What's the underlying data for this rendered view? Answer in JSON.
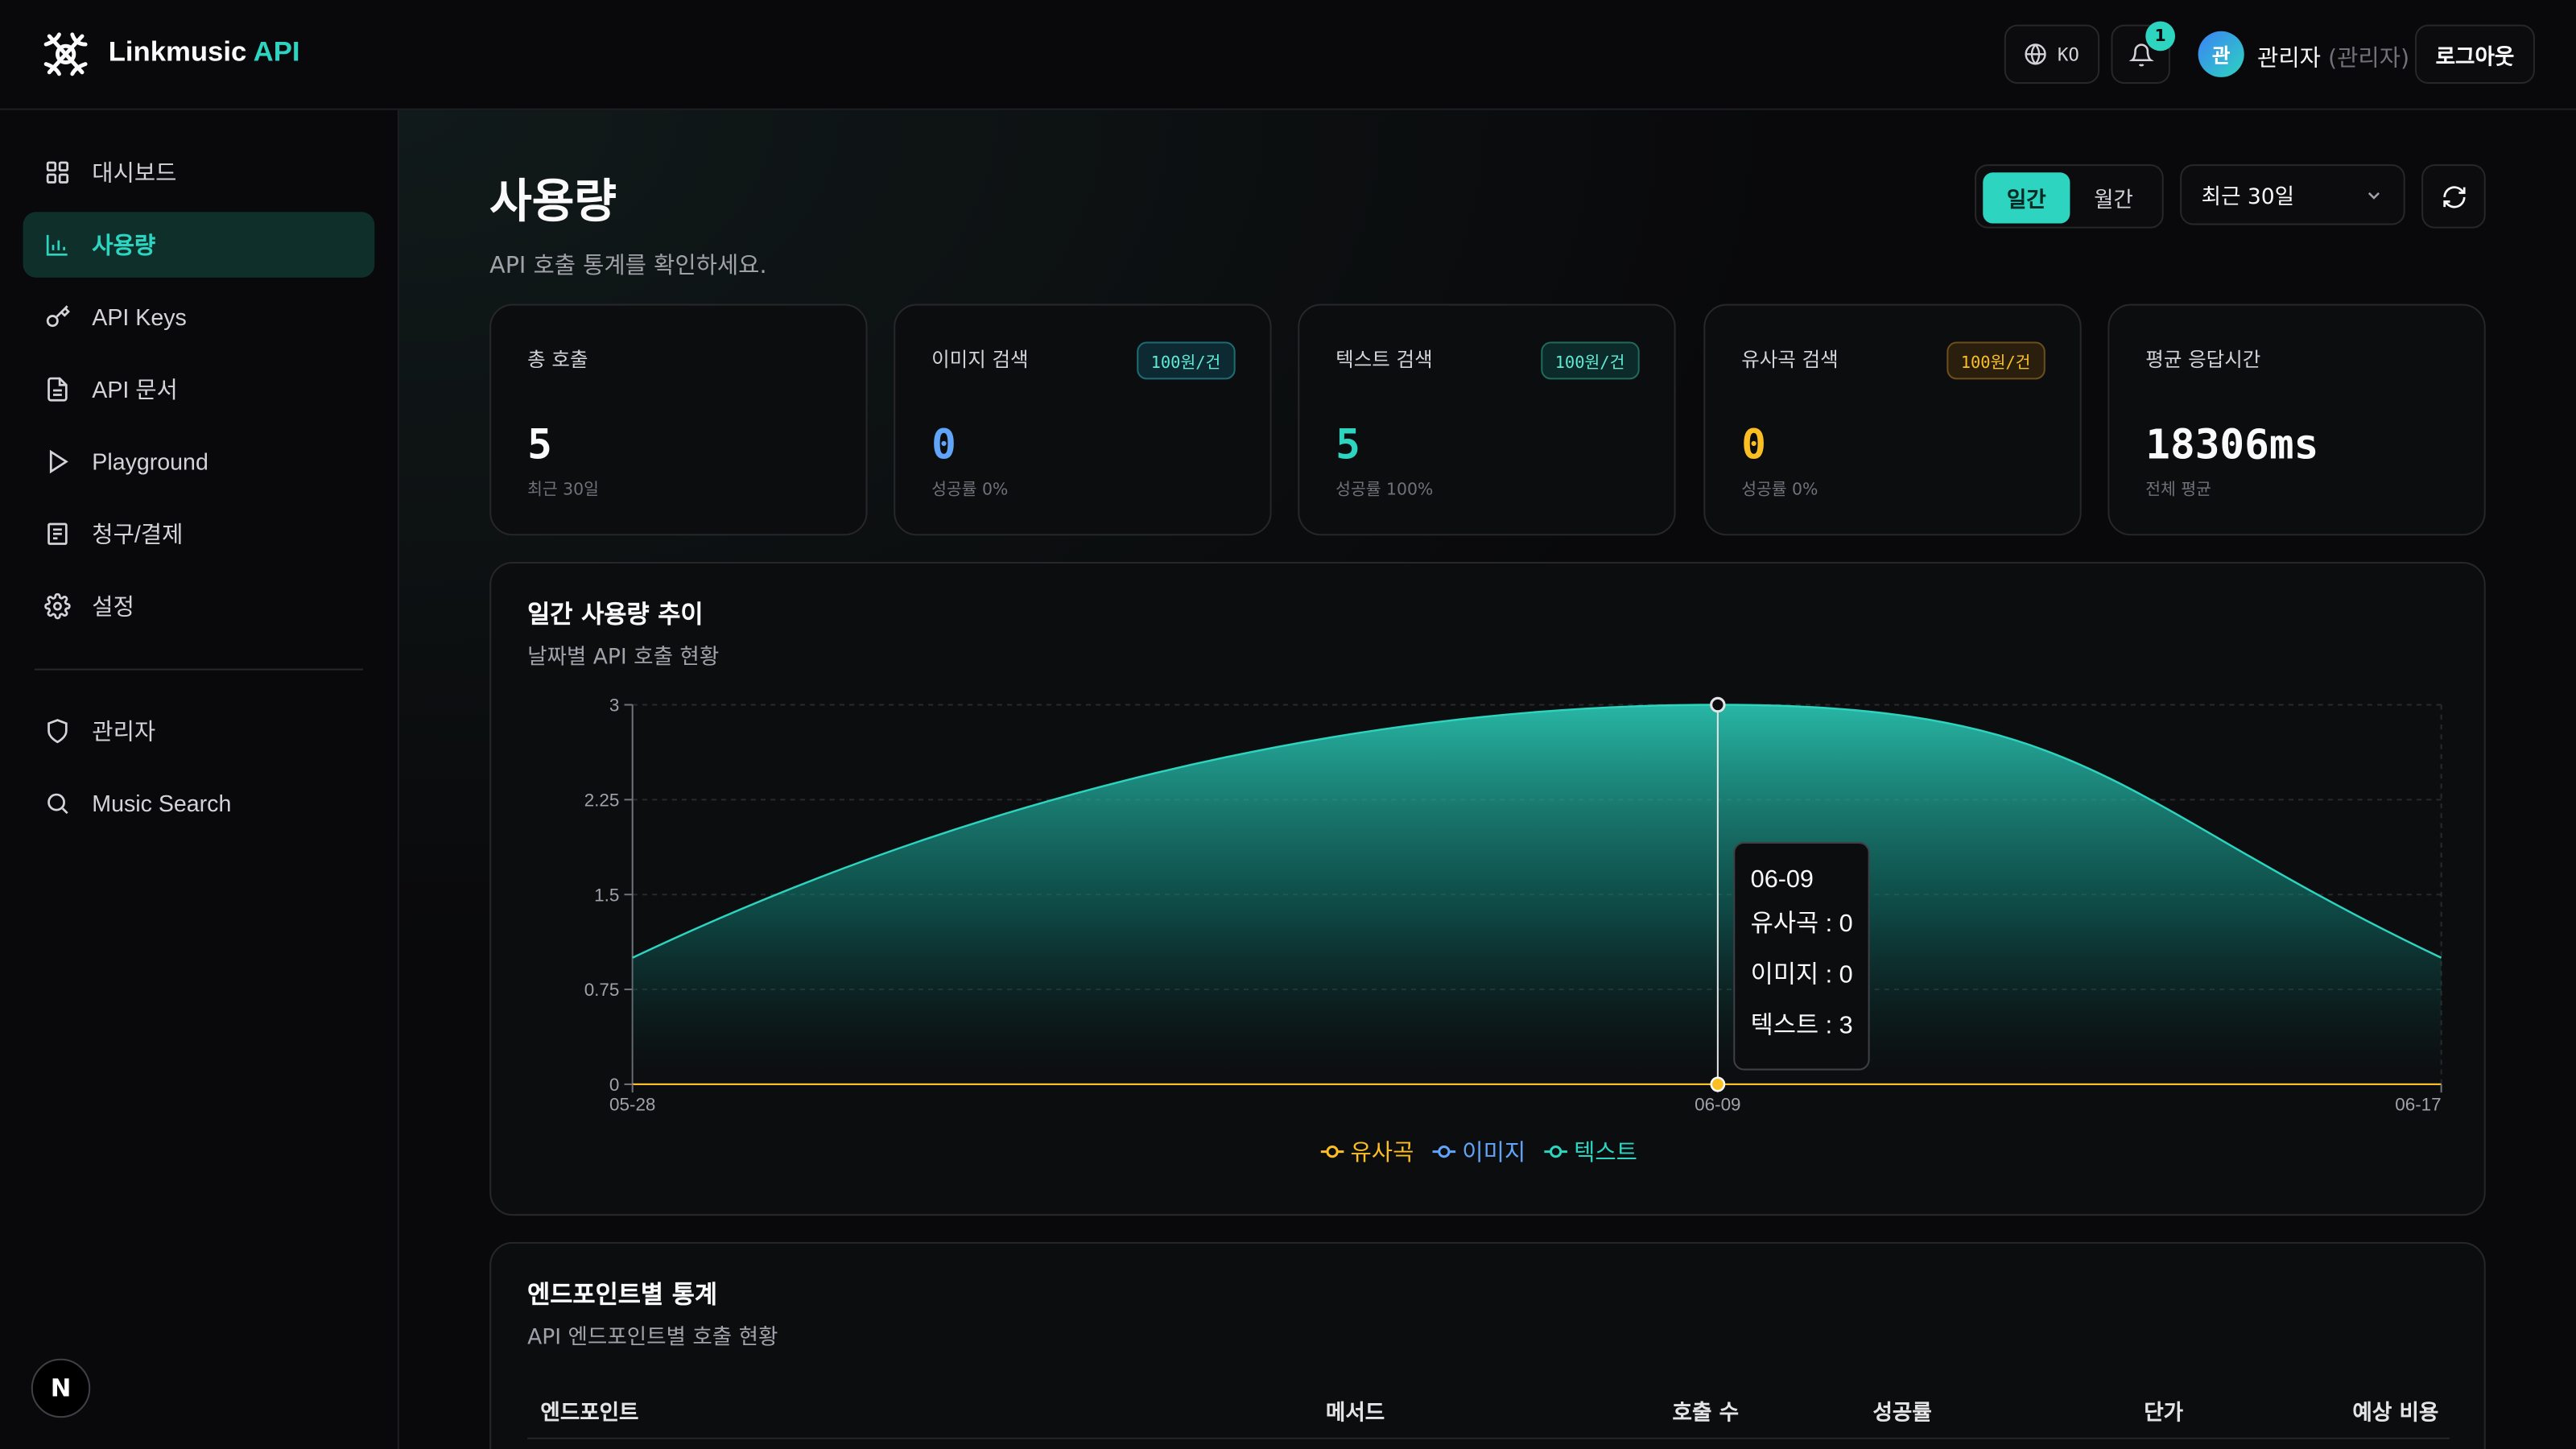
{
  "header": {
    "brand_main": "Linkmusic",
    "brand_accent": "API",
    "lang": "KO",
    "notification_count": "1",
    "avatar_initial": "관",
    "user_name": "관리자",
    "user_role": "(관리자)",
    "logout_label": "로그아웃"
  },
  "sidebar": {
    "items": [
      {
        "label": "대시보드",
        "icon": "grid-icon"
      },
      {
        "label": "사용량",
        "icon": "bar-chart-icon",
        "active": true
      },
      {
        "label": "API Keys",
        "icon": "key-icon"
      },
      {
        "label": "API 문서",
        "icon": "document-icon"
      },
      {
        "label": "Playground",
        "icon": "play-icon"
      },
      {
        "label": "청구/결제",
        "icon": "receipt-icon"
      },
      {
        "label": "설정",
        "icon": "gear-icon"
      }
    ],
    "admin_items": [
      {
        "label": "관리자",
        "icon": "shield-icon"
      },
      {
        "label": "Music Search",
        "icon": "search-icon"
      }
    ],
    "footer_badge": "N"
  },
  "main": {
    "title": "사용량",
    "subtitle": "API 호출 통계를 확인하세요.",
    "period_toggle": {
      "daily": "일간",
      "monthly": "월간",
      "selected": "일간"
    },
    "range_select": "최근 30일"
  },
  "stats": [
    {
      "label": "총 호출",
      "value": "5",
      "note": "최근 30일",
      "price": "",
      "color": "#fafafa"
    },
    {
      "label": "이미지 검색",
      "value": "0",
      "note": "성공률 0%",
      "price": "100원/건",
      "color": "#60a5fa"
    },
    {
      "label": "텍스트 검색",
      "value": "5",
      "note": "성공률 100%",
      "price": "100원/건",
      "color": "#2dd4bf"
    },
    {
      "label": "유사곡 검색",
      "value": "0",
      "note": "성공률 0%",
      "price": "100원/건",
      "color": "#fbbf24"
    },
    {
      "label": "평균 응답시간",
      "value": "18306ms",
      "note": "전체 평균",
      "price": "",
      "color": "#fafafa"
    }
  ],
  "usage_chart": {
    "title": "일간 사용량 추이",
    "subtitle": "날짜별 API 호출 현황"
  },
  "chart_data": {
    "type": "area",
    "x": [
      "05-28",
      "06-09",
      "06-17"
    ],
    "series": [
      {
        "name": "유사곡",
        "values": [
          0,
          0,
          0
        ],
        "color": "#fbbf24"
      },
      {
        "name": "이미지",
        "values": [
          0,
          0,
          0
        ],
        "color": "#60a5fa"
      },
      {
        "name": "텍스트",
        "values": [
          1,
          3,
          1
        ],
        "color": "#2dd4bf"
      }
    ],
    "yticks": [
      "0",
      "0.75",
      "1.5",
      "2.25",
      "3"
    ],
    "ylim": [
      0,
      3
    ],
    "grid": true,
    "legend": "bottom",
    "tooltip": {
      "date": "06-09",
      "lines": [
        "유사곡 : 0",
        "이미지 : 0",
        "텍스트 : 3"
      ]
    }
  },
  "endpoints": {
    "title": "엔드포인트별 통계",
    "subtitle": "API 엔드포인트별 호출 현황",
    "columns": [
      "엔드포인트",
      "메서드",
      "호출 수",
      "성공률",
      "단가",
      "예상 비용"
    ]
  }
}
